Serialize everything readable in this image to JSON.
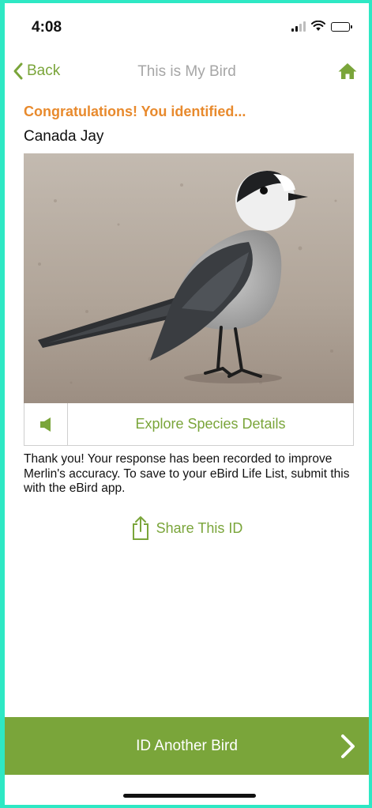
{
  "status_bar": {
    "time": "4:08"
  },
  "nav": {
    "back_label": "Back",
    "title": "This is My Bird"
  },
  "result": {
    "congrats": "Congratulations! You identified...",
    "species": "Canada Jay"
  },
  "actions": {
    "explore_label": "Explore Species Details",
    "share_label": "Share This ID"
  },
  "message": "Thank you! Your response has been recorded to improve Merlin's accuracy. To save to your eBird Life List, submit this with the eBird app.",
  "bottom": {
    "id_another_label": "ID Another Bird"
  },
  "colors": {
    "accent_green": "#7aa53a",
    "congrats_orange": "#e88a2d",
    "title_gray": "#a6a6a6"
  },
  "icons": {
    "back": "chevron-left-icon",
    "home": "home-icon",
    "sound": "speaker-icon",
    "share": "share-icon",
    "next": "chevron-right-icon"
  }
}
